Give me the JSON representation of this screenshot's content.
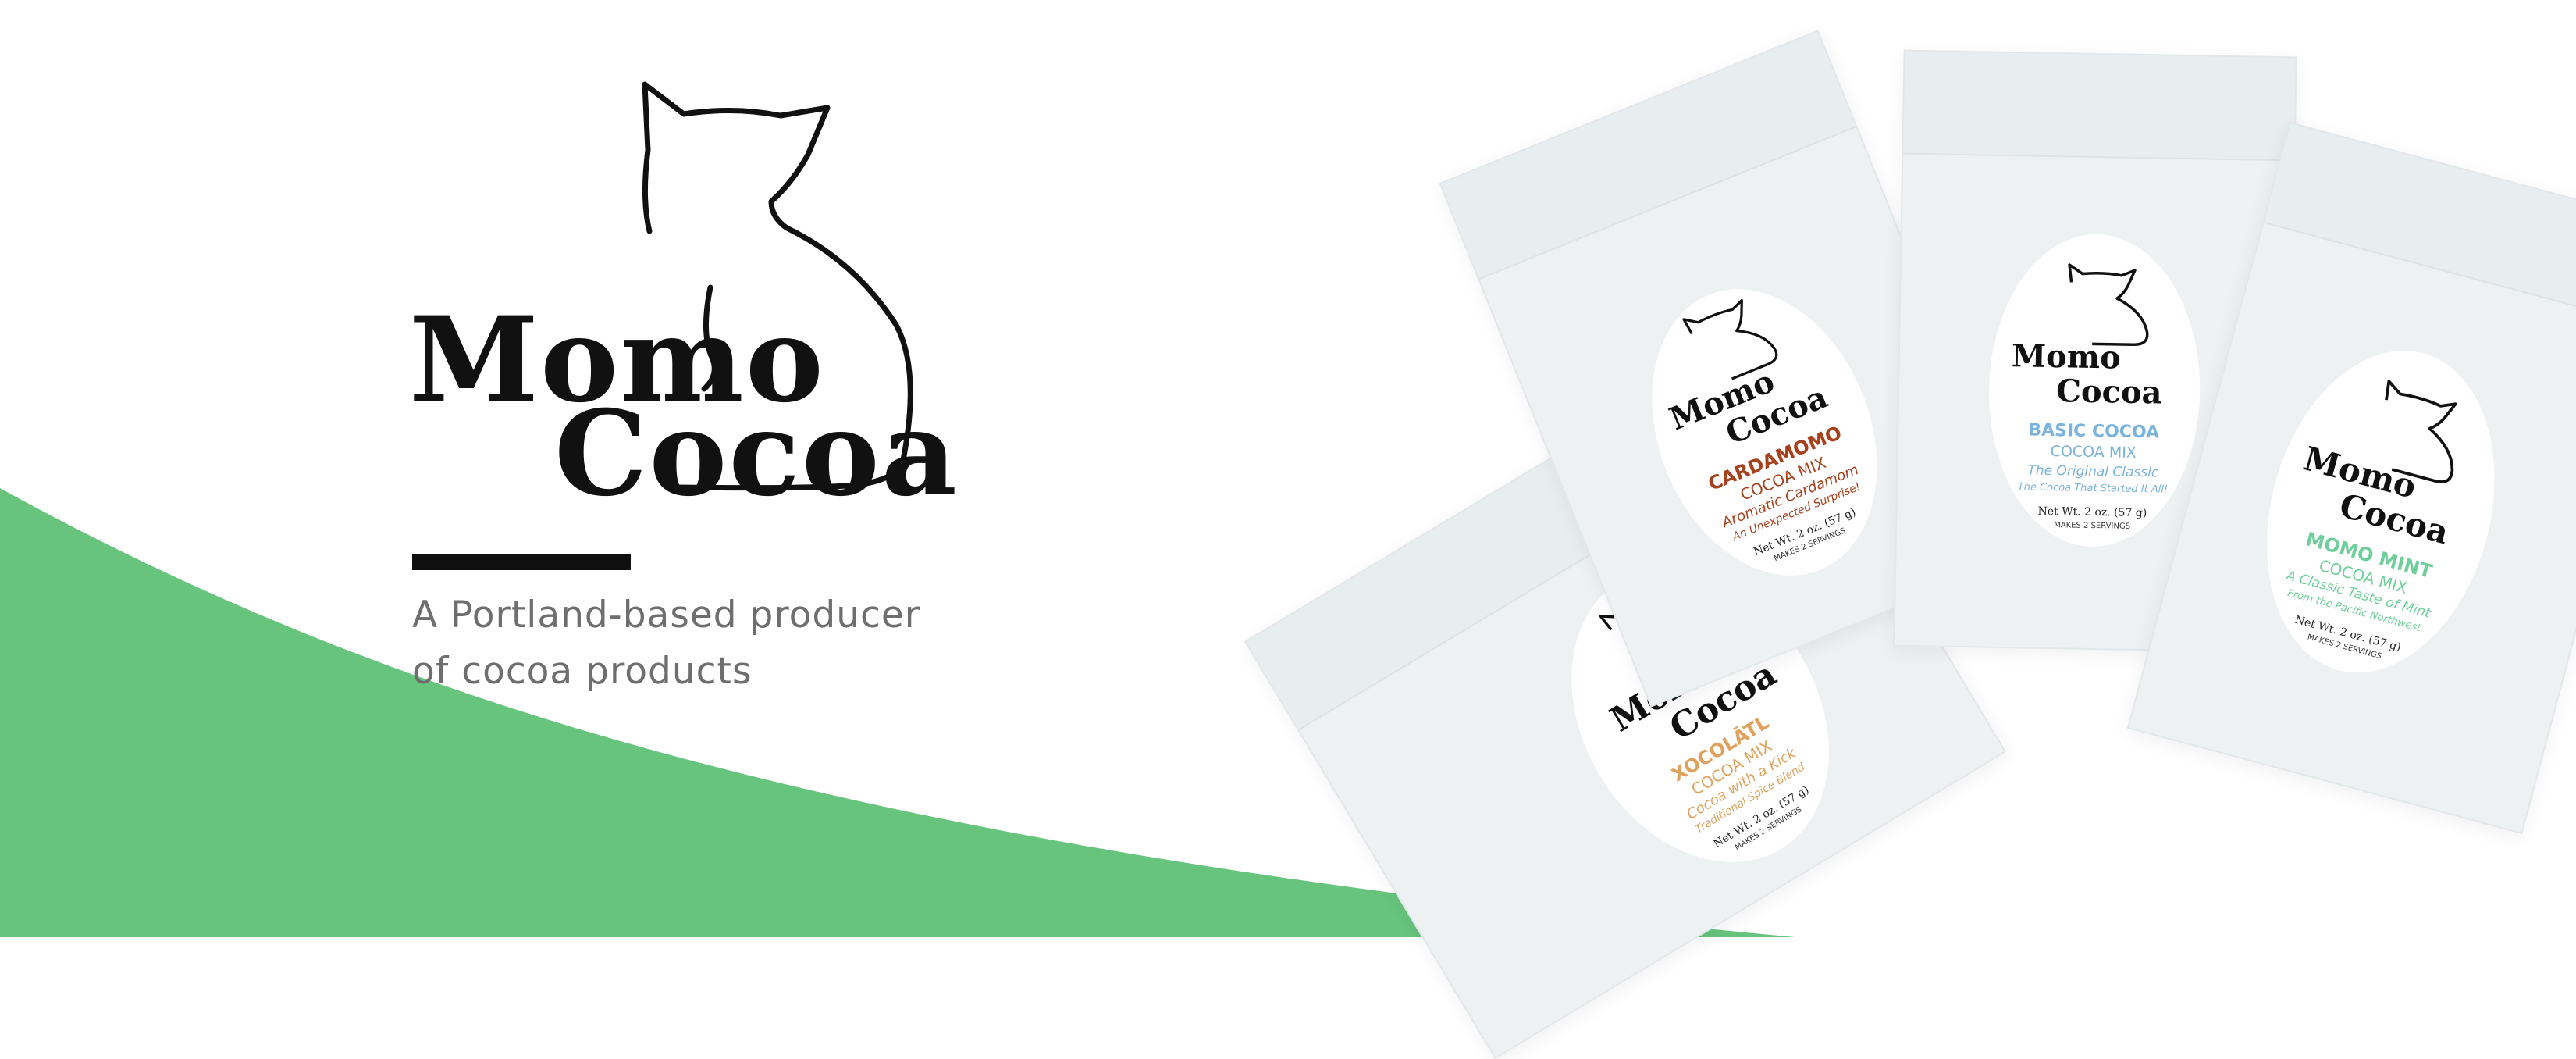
{
  "brand": {
    "word1": "Momo",
    "word2": "Cocoa",
    "tagline_line1": "A Portland-based producer",
    "tagline_line2": "of cocoa products"
  },
  "colors": {
    "accent_green": "#66c47c",
    "rule": "#0f0f0f",
    "tagline": "#6e6e6e"
  },
  "products": [
    {
      "flavor": "XOCOLĀTL",
      "mix": "COCOA MIX",
      "desc": "Cocoa with a Kick",
      "sub": "Traditional Spice Blend",
      "net": "Net Wt. 2 oz. (57 g)",
      "servings": "MAKES 2 SERVINGS",
      "color": "#e0a15c"
    },
    {
      "flavor": "CARDAMOMO",
      "mix": "COCOA MIX",
      "desc": "Aromatic Cardamom",
      "sub": "An Unexpected Surprise!",
      "net": "Net Wt. 2 oz. (57 g)",
      "servings": "MAKES 2 SERVINGS",
      "color": "#a8401c"
    },
    {
      "flavor": "BASIC COCOA",
      "mix": "COCOA MIX",
      "desc": "The Original Classic",
      "sub": "The Cocoa That Started It All!",
      "net": "Net Wt. 2 oz. (57 g)",
      "servings": "MAKES 2 SERVINGS",
      "color": "#7bb3dc"
    },
    {
      "flavor": "MOMO MINT",
      "mix": "COCOA MIX",
      "desc": "A Classic Taste of Mint",
      "sub": "From the Pacific Northwest",
      "net": "Net Wt. 2 oz. (57 g)",
      "servings": "MAKES 2 SERVINGS",
      "color": "#6fcf9a"
    }
  ]
}
